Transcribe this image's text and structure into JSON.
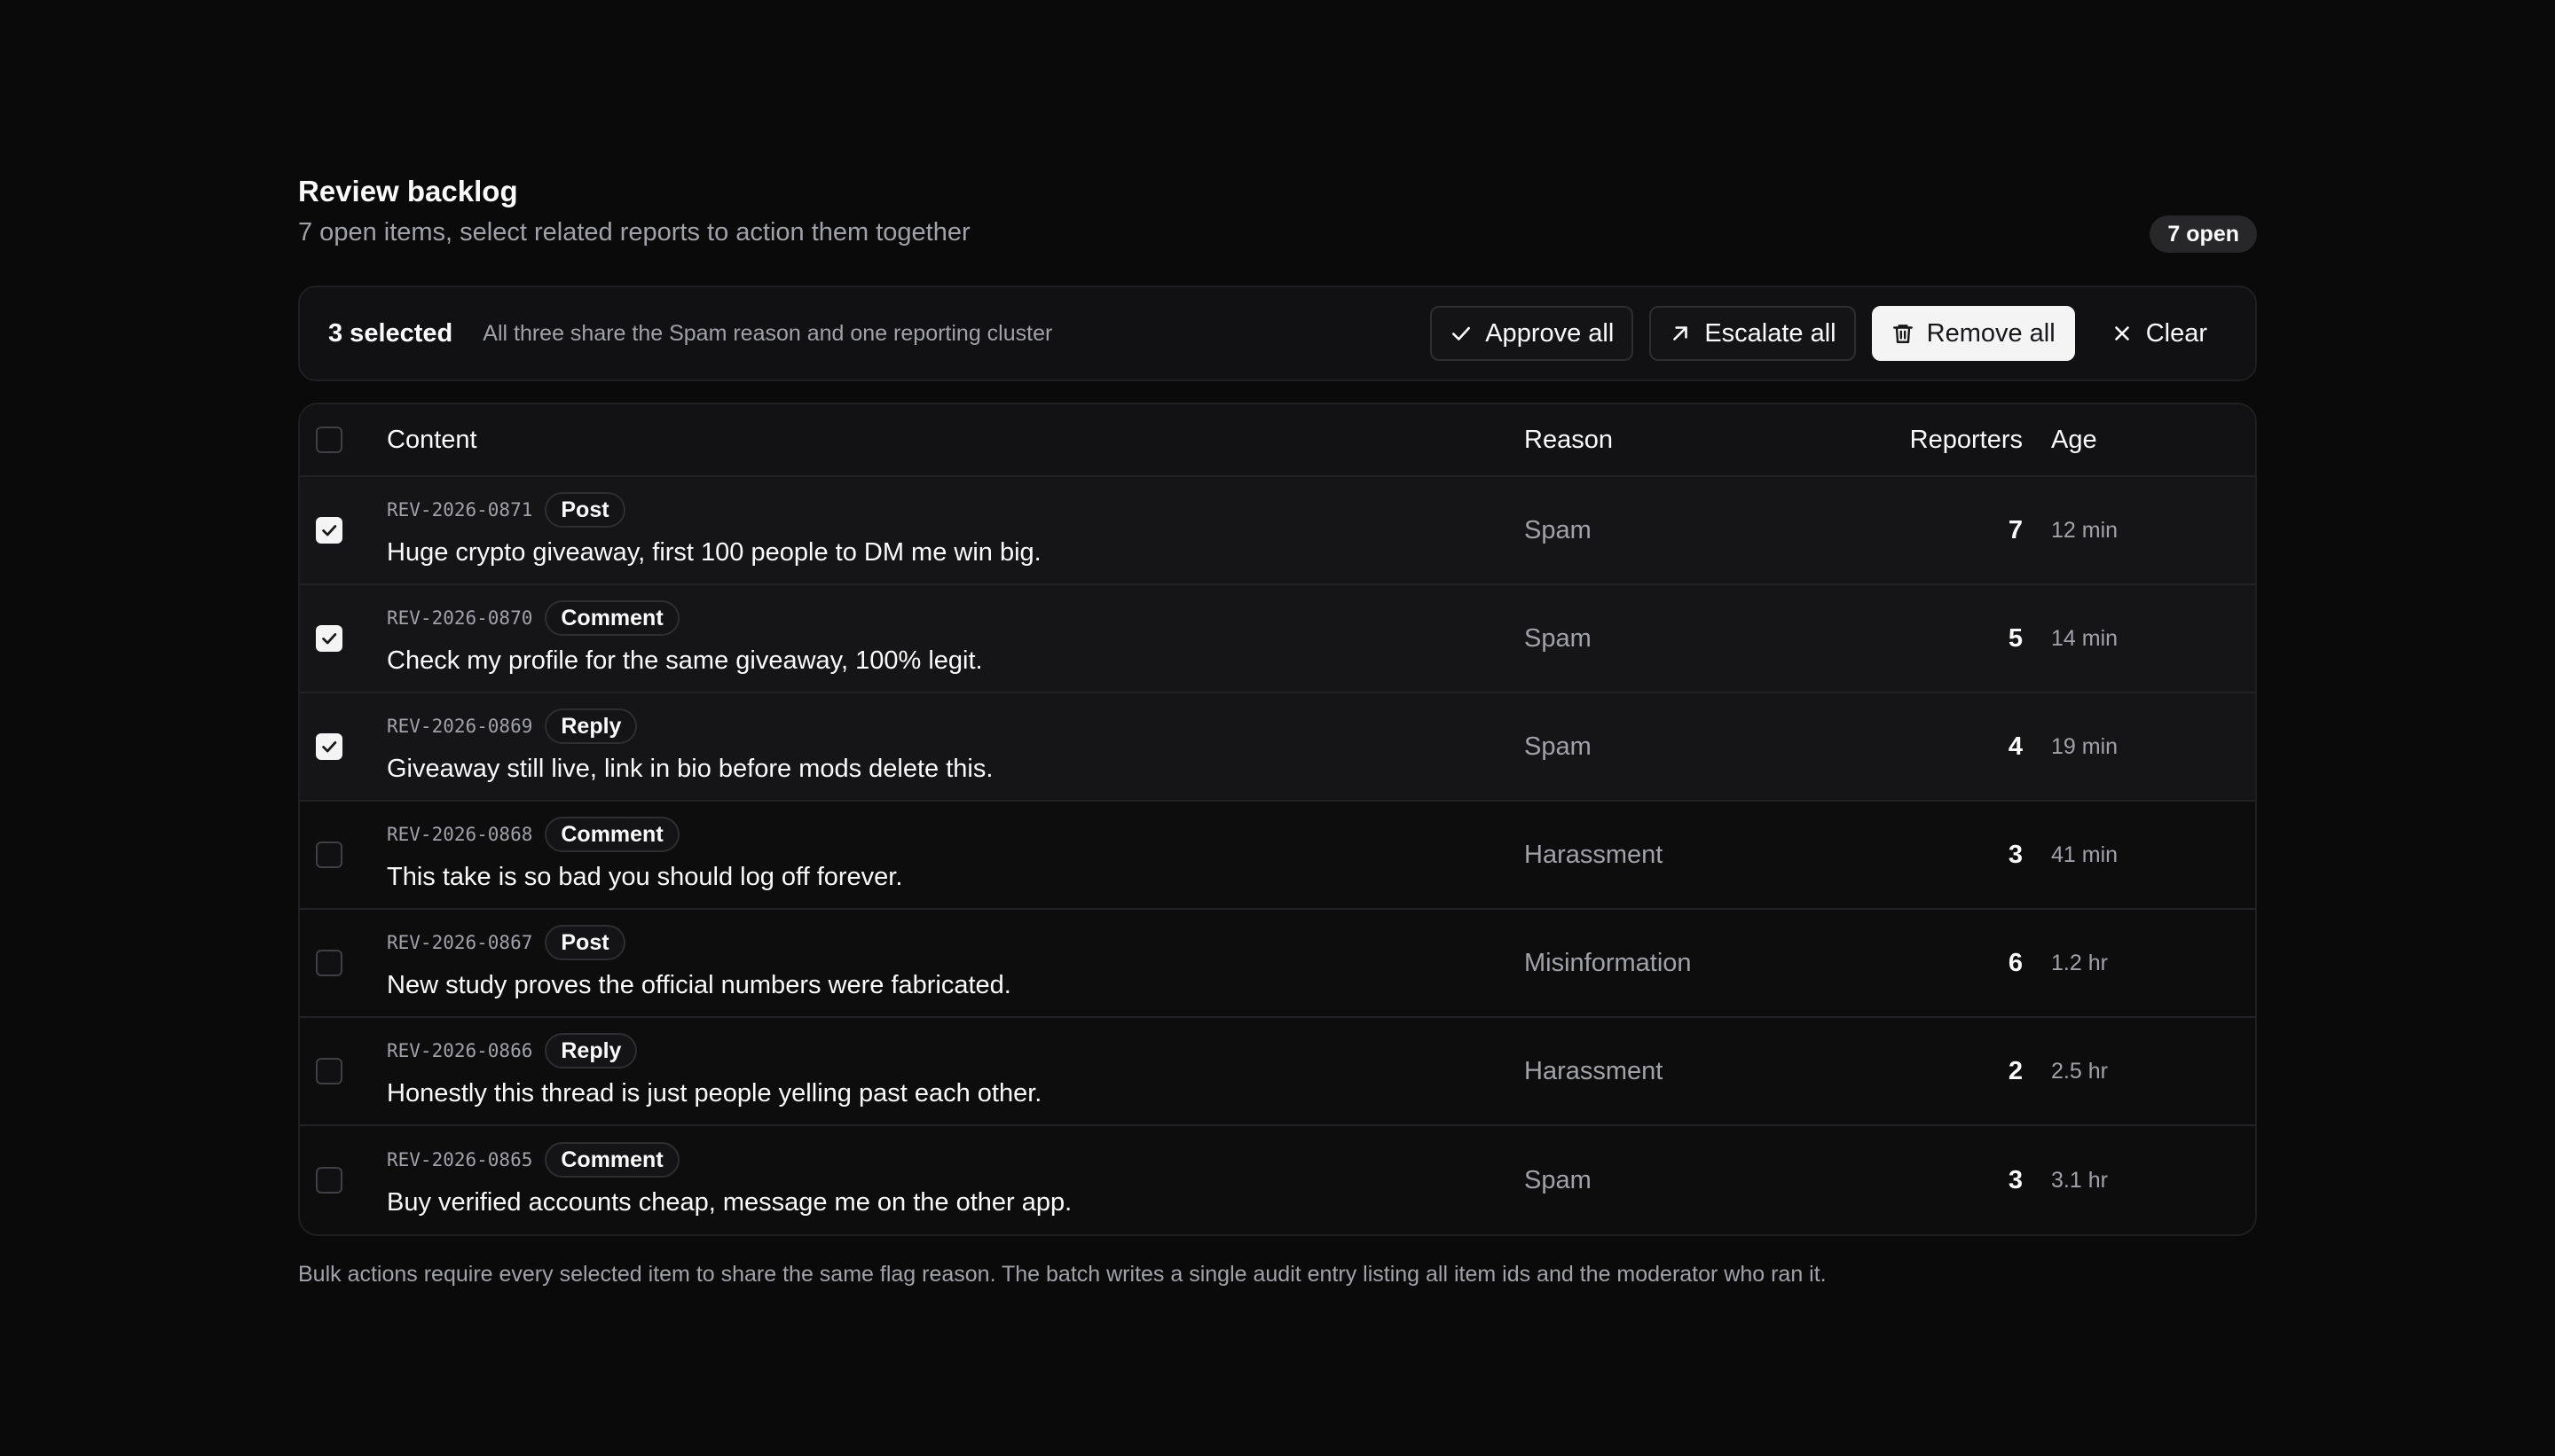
{
  "header": {
    "title": "Review backlog",
    "subtitle": "7 open items, select related reports to action them together",
    "open_badge": "7 open"
  },
  "bulk_bar": {
    "selected_label": "3 selected",
    "note": "All three share the Spam reason and one reporting cluster",
    "actions": {
      "approve": {
        "label": "Approve all",
        "icon": "check-icon"
      },
      "escalate": {
        "label": "Escalate all",
        "icon": "arrow-up-right-icon"
      },
      "remove": {
        "label": "Remove all",
        "icon": "trash-icon"
      },
      "clear": {
        "label": "Clear",
        "icon": "close-icon"
      }
    }
  },
  "table": {
    "columns": {
      "content": "Content",
      "reason": "Reason",
      "reporters": "Reporters",
      "age": "Age"
    },
    "rows": [
      {
        "id": "REV-2026-0871",
        "type": "Post",
        "text": "Huge crypto giveaway, first 100 people to DM me win big.",
        "reason": "Spam",
        "reporters": "7",
        "age": "12 min",
        "selected": true
      },
      {
        "id": "REV-2026-0870",
        "type": "Comment",
        "text": "Check my profile for the same giveaway, 100% legit.",
        "reason": "Spam",
        "reporters": "5",
        "age": "14 min",
        "selected": true
      },
      {
        "id": "REV-2026-0869",
        "type": "Reply",
        "text": "Giveaway still live, link in bio before mods delete this.",
        "reason": "Spam",
        "reporters": "4",
        "age": "19 min",
        "selected": true
      },
      {
        "id": "REV-2026-0868",
        "type": "Comment",
        "text": "This take is so bad you should log off forever.",
        "reason": "Harassment",
        "reporters": "3",
        "age": "41 min",
        "selected": false
      },
      {
        "id": "REV-2026-0867",
        "type": "Post",
        "text": "New study proves the official numbers were fabricated.",
        "reason": "Misinformation",
        "reporters": "6",
        "age": "1.2 hr",
        "selected": false
      },
      {
        "id": "REV-2026-0866",
        "type": "Reply",
        "text": "Honestly this thread is just people yelling past each other.",
        "reason": "Harassment",
        "reporters": "2",
        "age": "2.5 hr",
        "selected": false
      },
      {
        "id": "REV-2026-0865",
        "type": "Comment",
        "text": "Buy verified accounts cheap, message me on the other app.",
        "reason": "Spam",
        "reporters": "3",
        "age": "3.1 hr",
        "selected": false
      }
    ]
  },
  "footnote": "Bulk actions require every selected item to share the same flag reason. The batch writes a single audit entry listing all item ids and the moderator who ran it.",
  "colors": {
    "background": "#0a0a0a",
    "surface": "#111113",
    "primary_button": "#f4f4f5",
    "muted_text": "#a1a1aa"
  }
}
